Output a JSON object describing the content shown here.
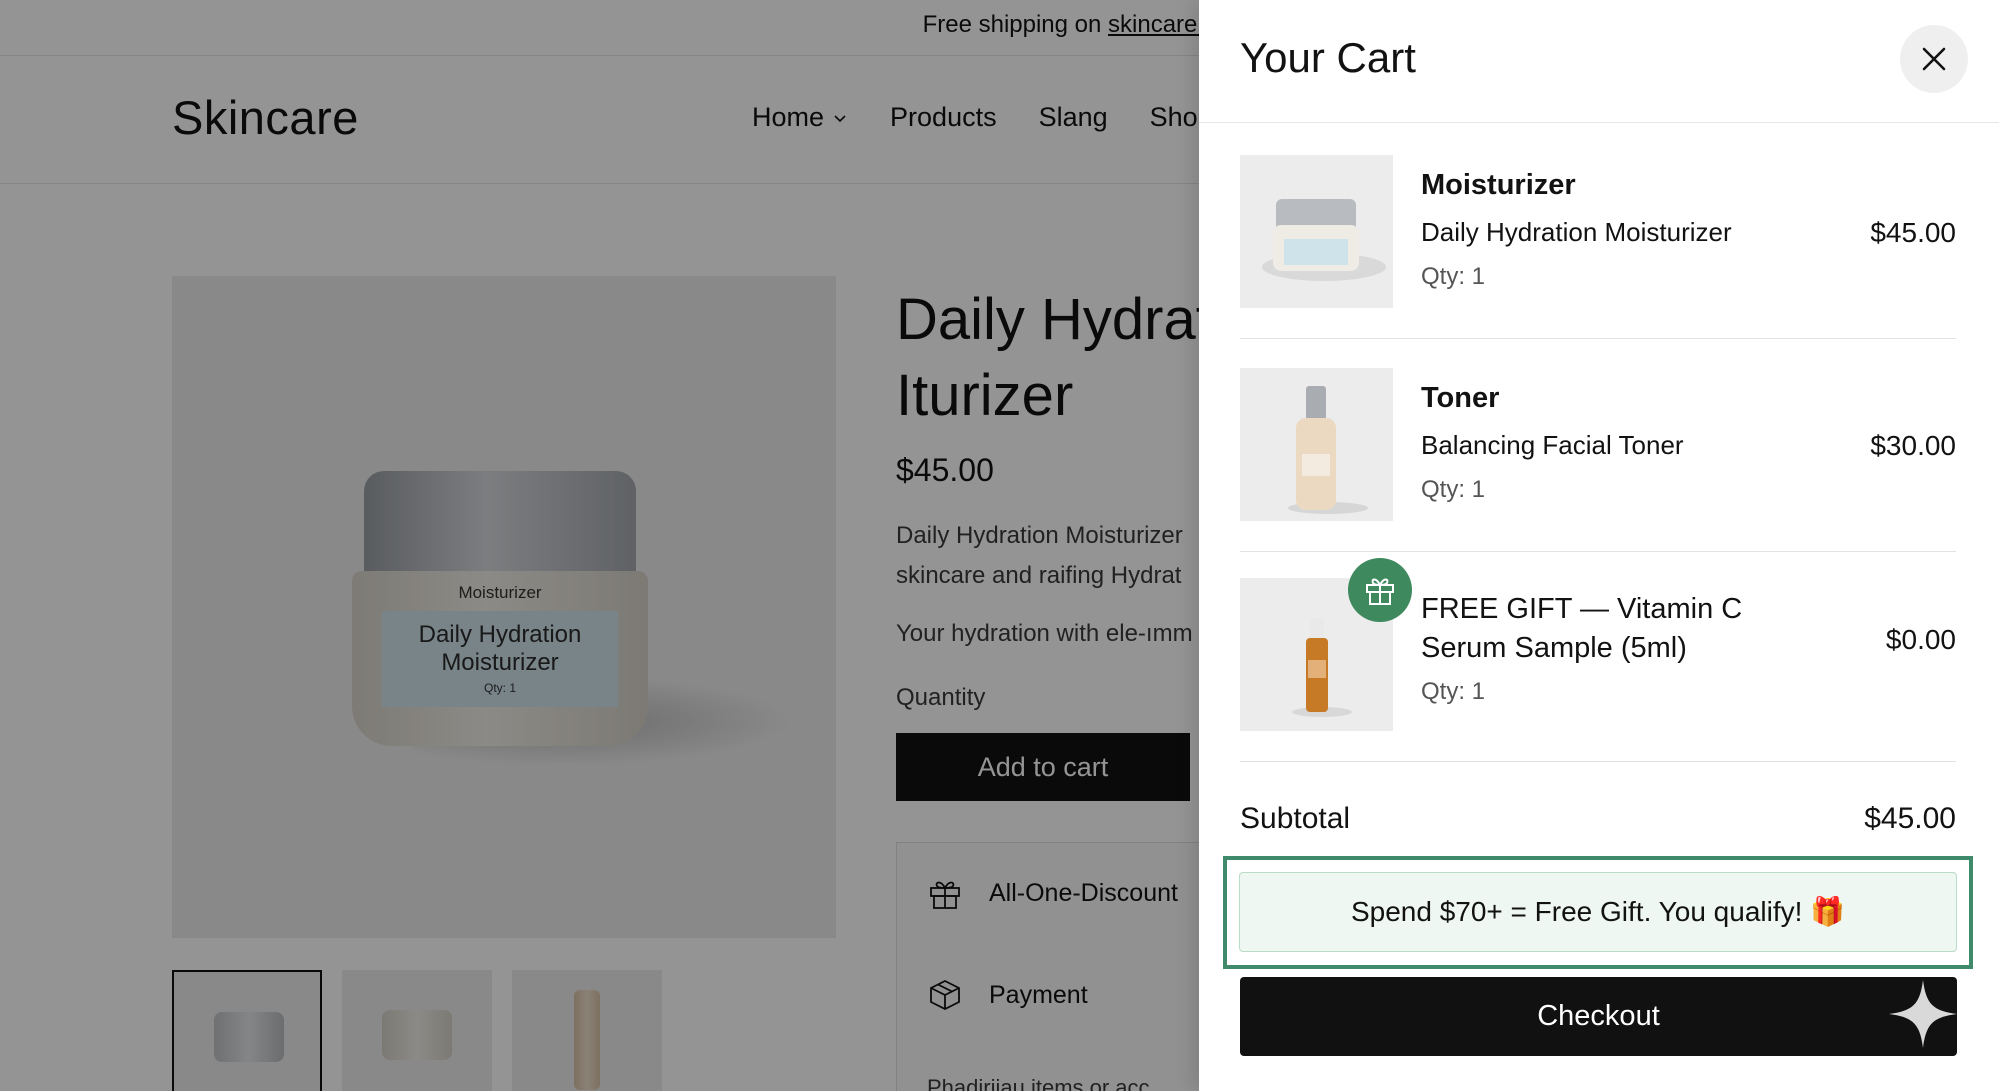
{
  "store": {
    "announcement_prefix": "Free shipping on",
    "announcement_link": "skincare store",
    "logo": "Skincare",
    "nav": [
      "Home",
      "Products",
      "Slang",
      "Shop"
    ],
    "product": {
      "title": "Daily Hydrat iturizer",
      "title_line1": "Daily Hydrat",
      "title_line2": "Iturizer",
      "price": "$45.00",
      "desc_line1": "Daily Hydration Moisturizer",
      "desc_line2": "skincare and raifing Hydrat",
      "desc_line3": "Your hydration with ele-ımm",
      "quantity_label": "Quantity",
      "add_to_cart": "Add to cart",
      "accordion": [
        "All-One-Discount",
        "Payment"
      ],
      "accordion_more": "Phadiriiau items or acc",
      "jar_label_top": "Moisturizer",
      "jar_label_main": "Daily Hydration Moisturizer",
      "jar_label_qty": "Qty: 1"
    }
  },
  "cart": {
    "title": "Your Cart",
    "items": [
      {
        "name": "Moisturizer",
        "subtitle": "Daily Hydration Moisturizer",
        "qty": "Qty: 1",
        "price": "$45.00"
      },
      {
        "name": "Toner",
        "subtitle": "Balancing Facial Toner",
        "qty": "Qty: 1",
        "price": "$30.00"
      },
      {
        "name": "FREE GIFT — Vitamin C Serum Sample (5ml)",
        "qty": "Qty: 1",
        "price": "$0.00"
      }
    ],
    "subtotal_label": "Subtotal",
    "subtotal_value": "$45.00",
    "promo_text": "Spend $70+ = Free Gift. You qualify! 🎁",
    "checkout_label": "Checkout",
    "colors": {
      "accent": "#3e8a6a",
      "gift_badge": "#3e8a5e",
      "promo_bg": "#eef7f1",
      "checkout_bg": "#111111"
    }
  }
}
